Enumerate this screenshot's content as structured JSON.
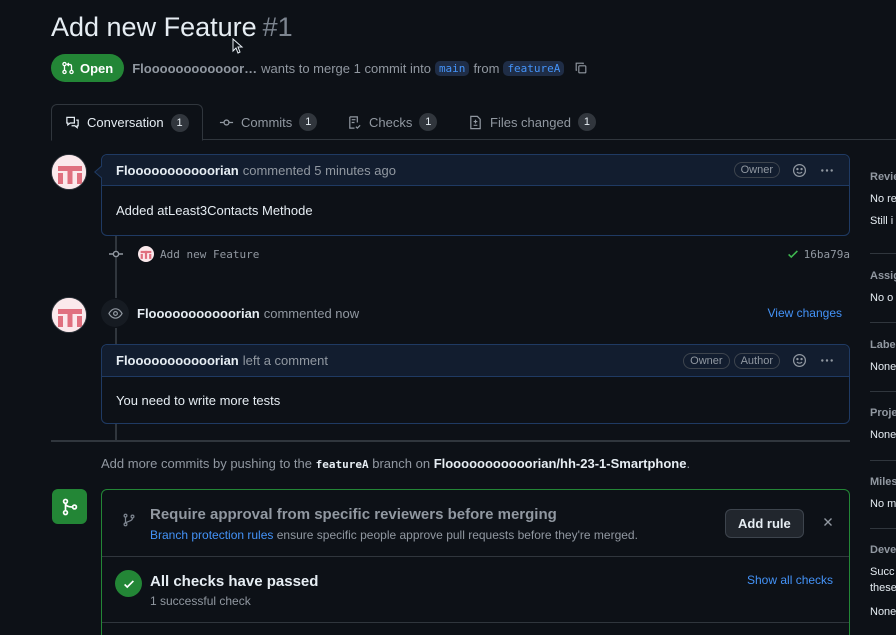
{
  "pr": {
    "title": "Add new Feature",
    "number": "#1",
    "state": "Open",
    "author_short": "Floooooooooooor…",
    "merge_text_a": "wants to merge 1 commit into",
    "base_branch": "main",
    "merge_text_b": "from",
    "head_branch": "featureA"
  },
  "tabs": [
    {
      "label": "Conversation",
      "count": "1"
    },
    {
      "label": "Commits",
      "count": "1"
    },
    {
      "label": "Checks",
      "count": "1"
    },
    {
      "label": "Files changed",
      "count": "1"
    }
  ],
  "comment1": {
    "author": "Flooooooooooorian",
    "action": "commented 5 minutes ago",
    "role": "Owner",
    "body": "Added atLeast3Contacts Methode"
  },
  "commit": {
    "message": "Add new Feature",
    "sha": "16ba79a"
  },
  "review_event": {
    "author": "Flooooooooooorian",
    "action": "commented now",
    "link": "View changes"
  },
  "comment2": {
    "author": "Flooooooooooorian",
    "action": "left a comment",
    "role1": "Owner",
    "role2": "Author",
    "body": "You need to write more tests"
  },
  "hint": {
    "a": "Add more commits by pushing to the",
    "branch": "featureA",
    "b": "branch on",
    "repo": "Flooooooooooorian/hh-23-1-Smartphone",
    "c": "."
  },
  "merge_box": {
    "rule_title": "Require approval from specific reviewers before merging",
    "rule_link": "Branch protection rules",
    "rule_text": "ensure specific people approve pull requests before they're merged.",
    "add_rule": "Add rule",
    "checks_title": "All checks have passed",
    "checks_sub": "1 successful check",
    "show_all": "Show all checks"
  },
  "sidebar": {
    "reviewers_h": "Revie",
    "reviewers_v1": "No re",
    "reviewers_v2": "Still i",
    "assignees_h": "Assig",
    "assignees_v": "No o",
    "labels_h": "Labe",
    "labels_v": "None",
    "projects_h": "Proje",
    "projects_v": "None",
    "milestone_h": "Miles",
    "milestone_v": "No m",
    "development_h": "Deve",
    "development_v1": "Succ",
    "development_v2": "these",
    "development_v3": "None"
  },
  "colors": {
    "bg": "#0d1117",
    "open_green": "#238636",
    "link_blue": "#4493f8",
    "muted": "#9198a1",
    "comment_border": "#1f3a63"
  }
}
